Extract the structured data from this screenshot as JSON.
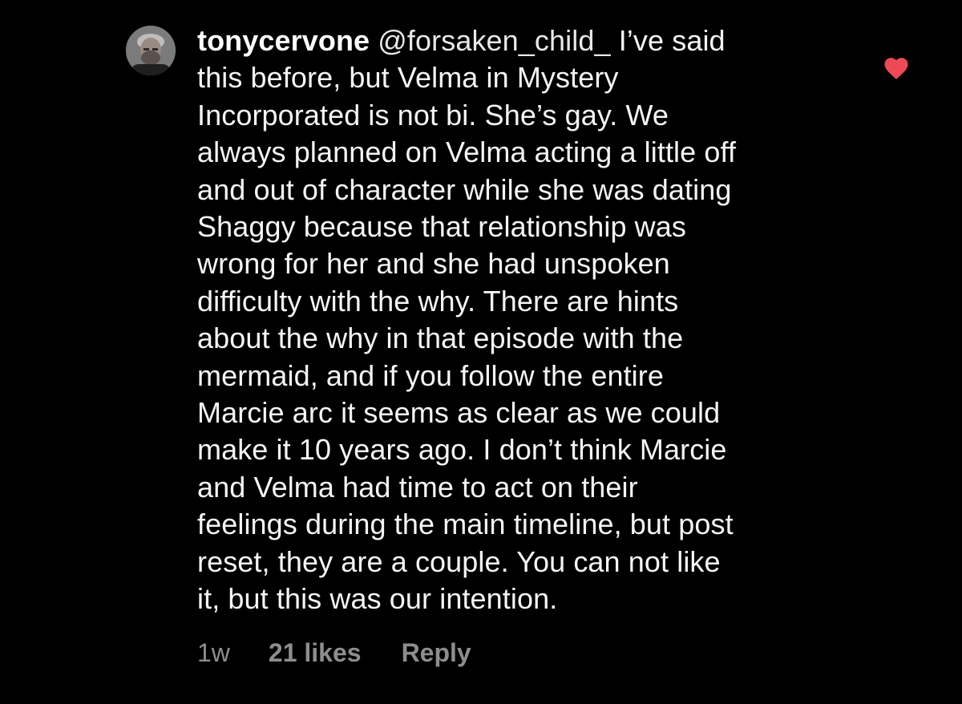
{
  "comment": {
    "avatar_icon": "profile-photo-avatar",
    "username": "tonycervone",
    "mention": "@forsaken_child_",
    "text_lines": [
      " I’ve said",
      "this before, but Velma in Mystery",
      "Incorporated is not bi. She’s gay. We",
      "always planned on Velma acting a little off",
      "and out of character while she was dating",
      "Shaggy because that relationship was",
      "wrong for her and she had unspoken",
      "difficulty with the why. There are hints",
      "about the why in that episode with the",
      "mermaid, and if you follow the entire",
      "Marcie arc it seems as clear as we could",
      "make it 10 years ago. I don’t think Marcie",
      "and Velma had time to act on their",
      "feelings during the main timeline, but post",
      "reset, they are a couple. You can not like",
      "it, but this was our intention."
    ],
    "liked": true,
    "like_icon": "heart-icon",
    "like_color": "#ed4956",
    "time": "1w",
    "likes": "21 likes",
    "reply_label": "Reply"
  },
  "colors": {
    "background": "#000000",
    "text": "#f5f5f5",
    "meta": "#8e8e8e"
  }
}
